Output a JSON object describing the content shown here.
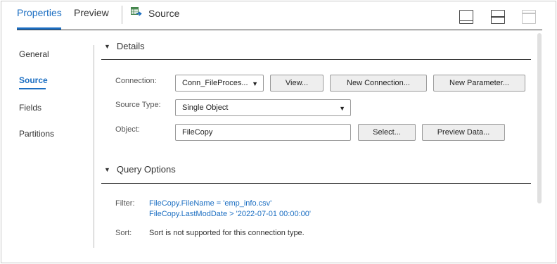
{
  "tabs": {
    "properties": "Properties",
    "preview": "Preview",
    "source": "Source"
  },
  "icons": {
    "source_tab": "table-arrow-icon",
    "layout_1": "panel-bottom-icon",
    "layout_2": "panel-split-icon",
    "layout_3": "panel-top-icon"
  },
  "nav": {
    "general": "General",
    "source": "Source",
    "fields": "Fields",
    "partitions": "Partitions"
  },
  "details": {
    "title": "Details",
    "connection_label": "Connection:",
    "connection_value": "Conn_FileProces...",
    "view_button": "View...",
    "new_connection_button": "New Connection...",
    "new_parameter_button": "New Parameter...",
    "source_type_label": "Source Type:",
    "source_type_value": "Single Object",
    "object_label": "Object:",
    "object_value": "FileCopy",
    "select_button": "Select...",
    "preview_data_button": "Preview Data..."
  },
  "query_options": {
    "title": "Query Options",
    "filter_label": "Filter:",
    "filter_line1": "FileCopy.FileName = 'emp_info.csv'",
    "filter_line2": "FileCopy.LastModDate > '2022-07-01 00:00:00'",
    "sort_label": "Sort:",
    "sort_value": "Sort is not supported for this connection type."
  },
  "colors": {
    "accent": "#1b6ec2",
    "text": "#333333"
  }
}
